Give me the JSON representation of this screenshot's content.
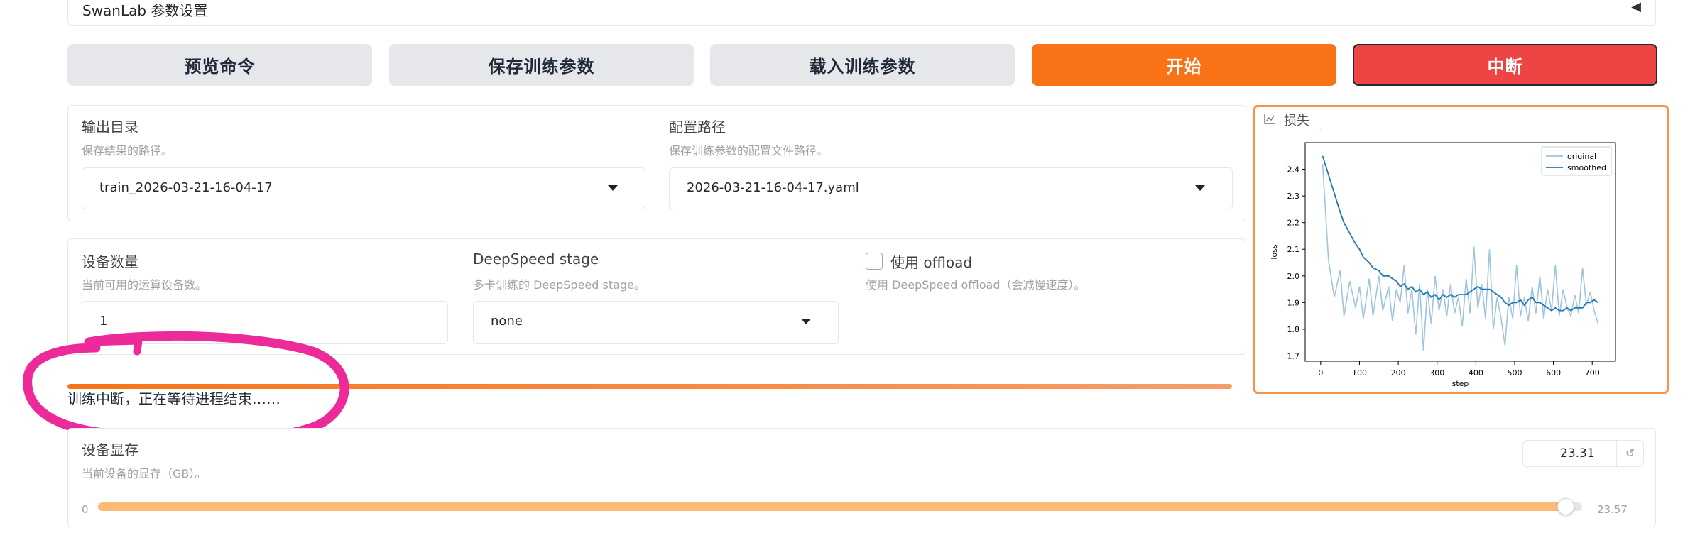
{
  "accordion": {
    "title": "SwanLab 参数设置"
  },
  "buttons": {
    "preview": "预览命令",
    "save": "保存训练参数",
    "load": "载入训练参数",
    "start": "开始",
    "abort": "中断"
  },
  "output_dir": {
    "label": "输出目录",
    "info": "保存结果的路径。",
    "value": "train_2026-03-21-16-04-17"
  },
  "config_path": {
    "label": "配置路径",
    "info": "保存训练参数的配置文件路径。",
    "value": "2026-03-21-16-04-17.yaml"
  },
  "device_count": {
    "label": "设备数量",
    "info": "当前可用的运算设备数。",
    "value": "1"
  },
  "deepspeed": {
    "label": "DeepSpeed stage",
    "info": "多卡训练的 DeepSpeed stage。",
    "value": "none"
  },
  "offload": {
    "label": "使用 offload",
    "info": "使用 DeepSpeed offload（会减慢速度）。",
    "checked": false
  },
  "status": {
    "text": "训练中断，正在等待进程结束……"
  },
  "device_memory": {
    "label": "设备显存",
    "info": "当前设备的显存（GB）。",
    "value": "23.31",
    "min": "0",
    "max": "23.57",
    "fraction": 0.989
  },
  "plot": {
    "tab_label": "损失",
    "chart_data": {
      "type": "line",
      "title": "",
      "xlabel": "step",
      "ylabel": "loss",
      "xlim": [
        -40,
        760
      ],
      "ylim": [
        1.68,
        2.5
      ],
      "xticks": [
        0,
        100,
        200,
        300,
        400,
        500,
        600,
        700
      ],
      "yticks": [
        1.7,
        1.8,
        1.9,
        2.0,
        2.1,
        2.2,
        2.3,
        2.4
      ],
      "legend": "top-right",
      "series": [
        {
          "name": "original",
          "color": "#9ec5de",
          "x": [
            5,
            20,
            35,
            50,
            60,
            75,
            90,
            100,
            110,
            125,
            135,
            150,
            160,
            175,
            185,
            195,
            205,
            215,
            225,
            235,
            245,
            255,
            265,
            275,
            285,
            295,
            305,
            315,
            325,
            335,
            345,
            355,
            365,
            375,
            385,
            395,
            405,
            415,
            425,
            435,
            445,
            455,
            465,
            475,
            485,
            495,
            505,
            515,
            525,
            535,
            545,
            555,
            565,
            575,
            585,
            595,
            605,
            615,
            625,
            635,
            645,
            655,
            665,
            675,
            685,
            695,
            705,
            715
          ],
          "y": [
            2.42,
            2.06,
            1.92,
            2.02,
            1.85,
            1.98,
            1.88,
            1.96,
            1.84,
            1.99,
            1.85,
            2.0,
            1.87,
            1.96,
            1.83,
            1.95,
            1.9,
            2.04,
            1.86,
            1.95,
            1.78,
            1.97,
            1.72,
            1.95,
            1.82,
            2.0,
            1.87,
            1.95,
            1.85,
            1.97,
            1.86,
            1.92,
            1.81,
            1.99,
            1.86,
            2.11,
            1.88,
            1.97,
            1.84,
            2.1,
            1.8,
            1.92,
            1.84,
            1.74,
            1.92,
            1.84,
            2.04,
            1.85,
            1.92,
            1.83,
            1.96,
            1.86,
            2.0,
            1.84,
            1.95,
            1.87,
            2.04,
            1.85,
            1.95,
            1.88,
            1.85,
            1.93,
            1.86,
            2.03,
            1.89,
            1.94,
            1.87,
            1.82
          ]
        },
        {
          "name": "smoothed",
          "color": "#1f77b4",
          "x": [
            5,
            20,
            35,
            50,
            60,
            75,
            90,
            100,
            110,
            125,
            135,
            150,
            160,
            175,
            185,
            195,
            205,
            215,
            225,
            235,
            245,
            255,
            265,
            275,
            285,
            295,
            305,
            315,
            325,
            335,
            345,
            355,
            365,
            375,
            385,
            395,
            405,
            415,
            425,
            435,
            445,
            455,
            465,
            475,
            485,
            495,
            505,
            515,
            525,
            535,
            545,
            555,
            565,
            575,
            585,
            595,
            605,
            615,
            625,
            635,
            645,
            655,
            665,
            675,
            685,
            695,
            705,
            715
          ],
          "y": [
            2.45,
            2.38,
            2.31,
            2.24,
            2.2,
            2.16,
            2.12,
            2.1,
            2.07,
            2.05,
            2.03,
            2.02,
            2.0,
            2.0,
            1.99,
            1.98,
            1.96,
            1.97,
            1.95,
            1.96,
            1.94,
            1.95,
            1.93,
            1.94,
            1.92,
            1.93,
            1.91,
            1.93,
            1.92,
            1.93,
            1.92,
            1.93,
            1.93,
            1.93,
            1.94,
            1.95,
            1.96,
            1.95,
            1.95,
            1.95,
            1.94,
            1.93,
            1.92,
            1.9,
            1.89,
            1.9,
            1.9,
            1.91,
            1.89,
            1.91,
            1.92,
            1.9,
            1.9,
            1.89,
            1.88,
            1.87,
            1.88,
            1.87,
            1.87,
            1.88,
            1.87,
            1.88,
            1.88,
            1.88,
            1.9,
            1.9,
            1.91,
            1.9
          ]
        }
      ]
    }
  }
}
